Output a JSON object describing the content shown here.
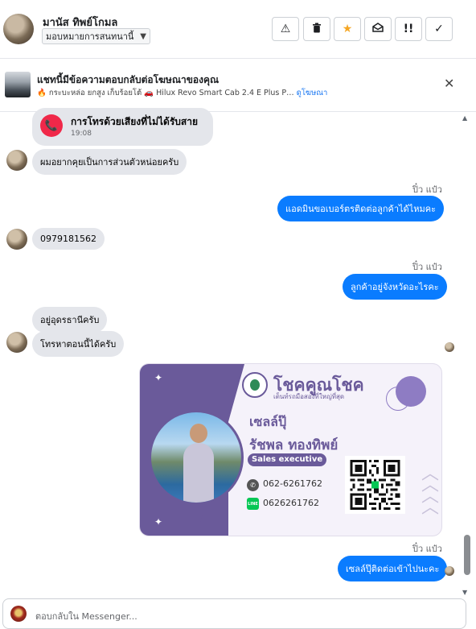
{
  "header": {
    "contact_name": "มานัส ทิพย์โกมล",
    "assign_label": "มอบหมายการสนทนานี้",
    "actions": [
      {
        "name": "warning-icon",
        "glyph": "⚠"
      },
      {
        "name": "trash-icon",
        "glyph": "🗑"
      },
      {
        "name": "star-icon",
        "glyph": "★"
      },
      {
        "name": "mark-unread-icon",
        "glyph": "✉"
      },
      {
        "name": "priority-icon",
        "glyph": "!!"
      },
      {
        "name": "check-icon",
        "glyph": "✓"
      }
    ]
  },
  "ad_banner": {
    "title": "แชทนี้มีข้อความตอบกลับต่อโฆษณาของคุณ",
    "subtitle": "🔥 กระบะหล่อ ยกสูง เก็บร้อยโต้ 🚗 Hilux Revo Smart Cab 2.4 E Plus P…",
    "link": "ดูโฆษณา",
    "close_glyph": "✕"
  },
  "messages": {
    "missed_call": {
      "title": "การโทรด้วยเสียงที่ไม่ได้รับสาย",
      "time": "19:08",
      "icon": "📞"
    },
    "in_1": "ผมอยากคุยเป็นการส่วนตัวหน่อยครับ",
    "sender_1": "ปิ๋ว แป๋ว",
    "out_1": "แอดมินขอเบอร์ตรติดต่อลูกค้าได้ไหมคะ",
    "in_2": "0979181562",
    "sender_2": "ปิ๋ว แป๋ว",
    "out_2": "ลูกค้าอยู่จังหวัดอะไรคะ",
    "in_3": "อยู่อุดรธานีครับ",
    "in_4": "โทรหาตอนนี้ได้ครับ",
    "sender_3": "ปิ๋ว แป๋ว",
    "out_3": "เซลล์ปุ๊ติดต่อเข้าไปนะคะ"
  },
  "namecard": {
    "brand": "โชคคูณโชค",
    "slogan": "เต็นท์รถมือสองที่ใหญ่ที่สุด",
    "nickname": "เซลล์ปุ๊",
    "full_name": "รัชพล ทองทิพย์",
    "role": "Sales executive",
    "phone": "062-6261762",
    "line_id": "0626261762",
    "line_badge": "LINE",
    "accent_color": "#6a5a9a"
  },
  "composer": {
    "placeholder": "ตอบกลับใน Messenger..."
  }
}
